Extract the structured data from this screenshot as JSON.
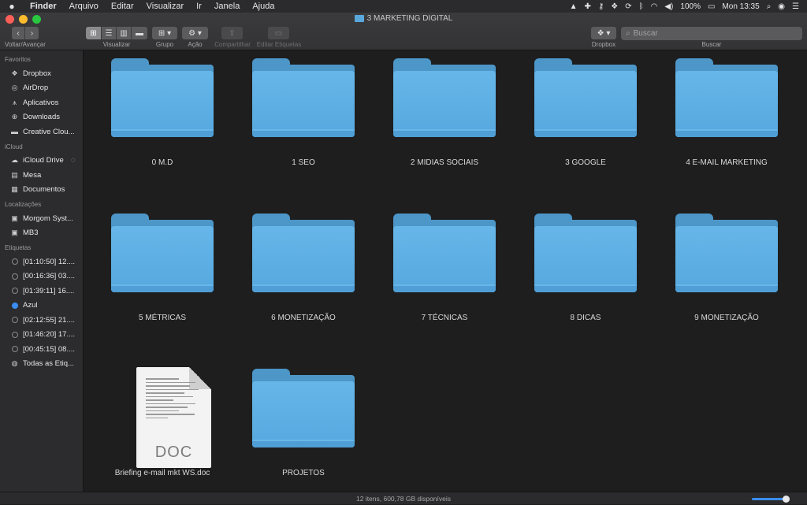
{
  "menubar": {
    "apple_icon": "apple-icon",
    "items": [
      "Finder",
      "Arquivo",
      "Editar",
      "Visualizar",
      "Ir",
      "Janela",
      "Ajuda"
    ],
    "battery": "100%",
    "clock": "Mon 13:35"
  },
  "window": {
    "title": "3 MARKETING DIGITAL",
    "toolbar": {
      "nav_label": "Voltar/Avançar",
      "view_label": "Visualizar",
      "group_label": "Grupo",
      "action_label": "Ação",
      "share_label": "Compartilhar",
      "tags_label": "Editar Etiquetas",
      "dropbox_label": "Dropbox",
      "search_label": "Buscar",
      "search_placeholder": "Buscar"
    }
  },
  "sidebar": {
    "favorites_header": "Favoritos",
    "favorites": [
      {
        "label": "Dropbox",
        "icon": "dropbox-icon"
      },
      {
        "label": "AirDrop",
        "icon": "airdrop-icon"
      },
      {
        "label": "Aplicativos",
        "icon": "applications-icon"
      },
      {
        "label": "Downloads",
        "icon": "downloads-icon"
      },
      {
        "label": "Creative Clou...",
        "icon": "folder-icon"
      }
    ],
    "icloud_header": "iCloud",
    "icloud": [
      {
        "label": "iCloud Drive",
        "icon": "cloud-icon"
      },
      {
        "label": "Mesa",
        "icon": "desktop-icon"
      },
      {
        "label": "Documentos",
        "icon": "documents-icon"
      }
    ],
    "locations_header": "Localizações",
    "locations": [
      {
        "label": "Morgom Syst...",
        "icon": "disk-icon"
      },
      {
        "label": "MB3",
        "icon": "disk-icon"
      }
    ],
    "tags_header": "Etiquetas",
    "tags": [
      {
        "label": "[01:10:50] 12...."
      },
      {
        "label": "[00:16:36] 03...."
      },
      {
        "label": "[01:39:11] 16...."
      },
      {
        "label": "Azul"
      },
      {
        "label": "[02:12:55] 21...."
      },
      {
        "label": "[01:46:20] 17...."
      },
      {
        "label": "[00:45:15] 08...."
      },
      {
        "label": "Todas as Etiq..."
      }
    ]
  },
  "items": [
    {
      "label": "0 M.D"
    },
    {
      "label": "1 SEO"
    },
    {
      "label": "2 MIDIAS SOCIAIS"
    },
    {
      "label": "3 GOOGLE"
    },
    {
      "label": "4 E-MAIL MARKETING"
    },
    {
      "label": "5 MÉTRICAS"
    },
    {
      "label": "6 MONETIZAÇÃO"
    },
    {
      "label": "7 TÉCNICAS"
    },
    {
      "label": "8 DICAS"
    },
    {
      "label": "9 MONETIZAÇÃO"
    },
    {
      "label": "Briefing e-mail mkt WS.doc",
      "doc_text": "DOC"
    },
    {
      "label": "PROJETOS"
    }
  ],
  "status": {
    "text": "12 itens, 600,78 GB disponíveis"
  },
  "colors": {
    "folder": "#56a8de",
    "accent": "#3a8ef0"
  }
}
